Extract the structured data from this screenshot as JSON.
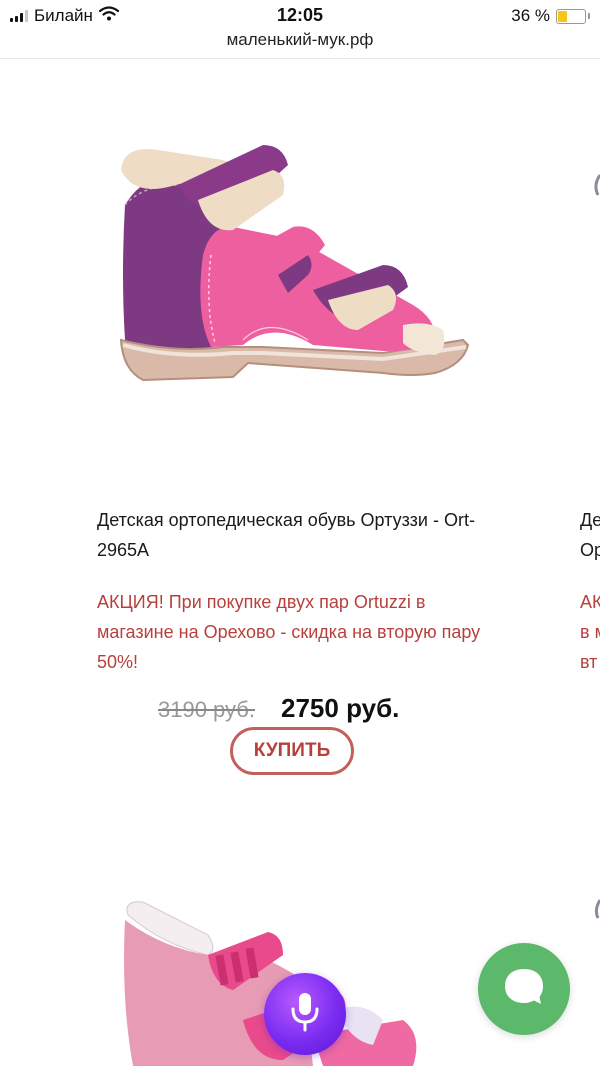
{
  "status_bar": {
    "carrier": "Билайн",
    "time": "12:05",
    "battery_percent": "36 %",
    "battery_level": 0.36,
    "url": "маленький-мук.рф"
  },
  "product": {
    "title": "Детская ортопедическая обувь Ортуззи - Ort-2965A",
    "promo": "АКЦИЯ! При покупке двух пар Ortuzzi в магазине на Орехово - скидка на вторую пару 50%!",
    "old_price": "3190 руб.",
    "new_price": "2750 руб.",
    "buy_label": "КУПИТЬ"
  },
  "next_product_peek": {
    "title": "Де\nОр",
    "promo": "АК\nв м\nвт"
  },
  "icons": {
    "wifi": "wifi-icon",
    "mic": "microphone-icon",
    "chat": "chat-bubble-icon"
  },
  "colors": {
    "promo": "#b8403c",
    "buy_border": "#c4605c",
    "chat": "#5cb86a",
    "mic": "#7a2cf0"
  }
}
